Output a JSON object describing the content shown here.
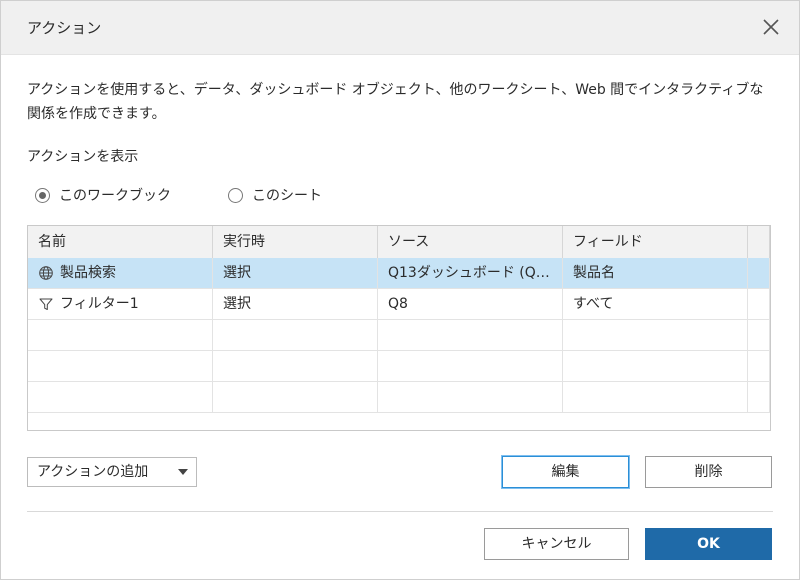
{
  "dialog": {
    "title": "アクション",
    "description": "アクションを使用すると、データ、ダッシュボード オブジェクト、他のワークシート、Web 間でインタラクティブな関係を作成できます。",
    "show_actions_label": "アクションを表示",
    "scope_options": [
      {
        "label": "このワークブック",
        "checked": true
      },
      {
        "label": "このシート",
        "checked": false
      }
    ]
  },
  "table": {
    "columns": [
      "名前",
      "実行時",
      "ソース",
      "フィールド"
    ],
    "rows": [
      {
        "icon": "globe-icon",
        "name": "製品検索",
        "run_on": "選択",
        "source": "Q13ダッシュボード (Q13)",
        "fields": "製品名",
        "selected": true
      },
      {
        "icon": "filter-icon",
        "name": "フィルター1",
        "run_on": "選択",
        "source": "Q8",
        "fields": "すべて",
        "selected": false
      }
    ]
  },
  "buttons": {
    "add_action": "アクションの追加",
    "edit": "編集",
    "delete": "削除",
    "cancel": "キャンセル",
    "ok": "OK"
  },
  "colors": {
    "selected_row": "#c6e3f6",
    "ok_button": "#1f6aa8",
    "focus_border": "#2b8fd6"
  }
}
